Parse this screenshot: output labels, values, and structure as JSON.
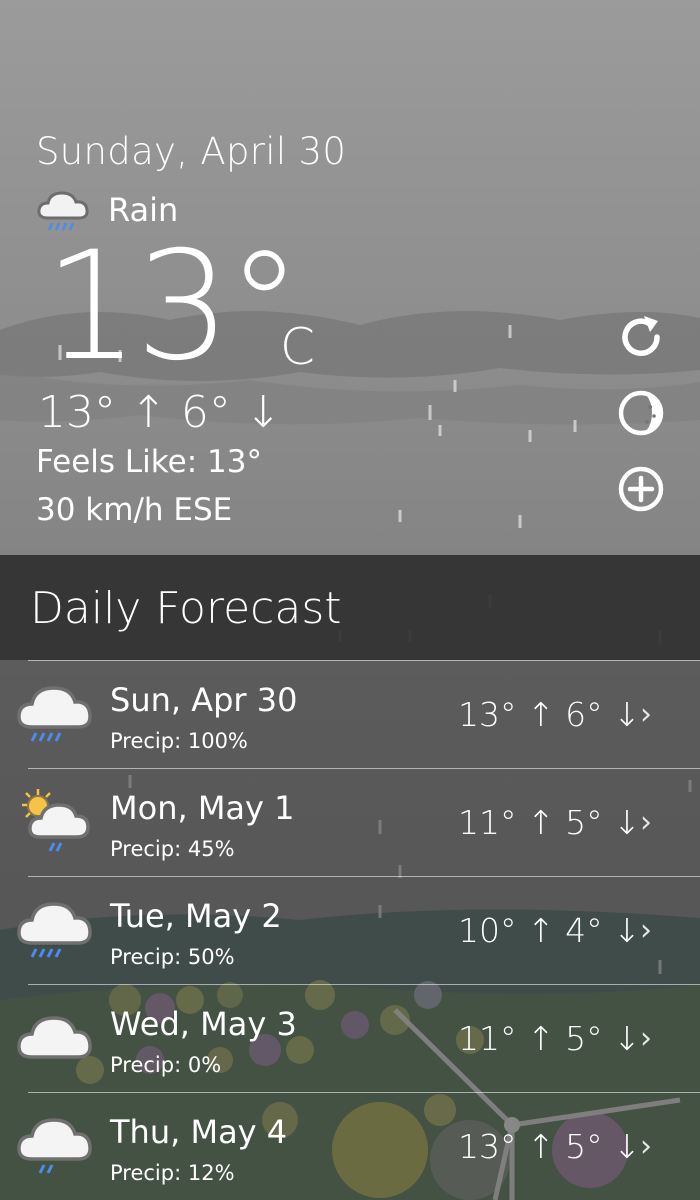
{
  "colors": {
    "sky_top": "#9a9a9a",
    "sky_bottom": "#6f6f6f",
    "header_band": "#303030",
    "text": "#ffffff",
    "sun": "#f5c24a",
    "rain": "#4a8cf0"
  },
  "current": {
    "date": "Sunday, April 30",
    "condition": "Rain",
    "condition_icon": "rain-cloud-icon",
    "temperature": "13°",
    "unit": "C",
    "hi_lo": "13° ↑  6° ↓",
    "feels_like": "Feels Like: 13°",
    "wind": "30 km/h ESE"
  },
  "actions": {
    "refresh_icon": "refresh-icon",
    "moon_icon": "moon-phase-icon",
    "add_icon": "add-location-icon"
  },
  "forecast": {
    "title": "Daily Forecast",
    "days": [
      {
        "name": "Sun, Apr 30",
        "precip": "Precip: 100%",
        "temps": "13° ↑  6° ↓",
        "icon": "heavy-rain-icon",
        "chevron": "›"
      },
      {
        "name": "Mon, May 1",
        "precip": "Precip: 45%",
        "temps": "11° ↑  5° ↓",
        "icon": "sun-cloud-rain-icon",
        "chevron": "›"
      },
      {
        "name": "Tue, May 2",
        "precip": "Precip: 50%",
        "temps": "10° ↑  4° ↓",
        "icon": "heavy-rain-icon",
        "chevron": "›"
      },
      {
        "name": "Wed, May 3",
        "precip": "Precip: 0%",
        "temps": "11° ↑  5° ↓",
        "icon": "cloud-icon",
        "chevron": "›"
      },
      {
        "name": "Thu, May 4",
        "precip": "Precip: 12%",
        "temps": "13° ↑  5° ↓",
        "icon": "light-rain-icon",
        "chevron": "›"
      }
    ]
  }
}
